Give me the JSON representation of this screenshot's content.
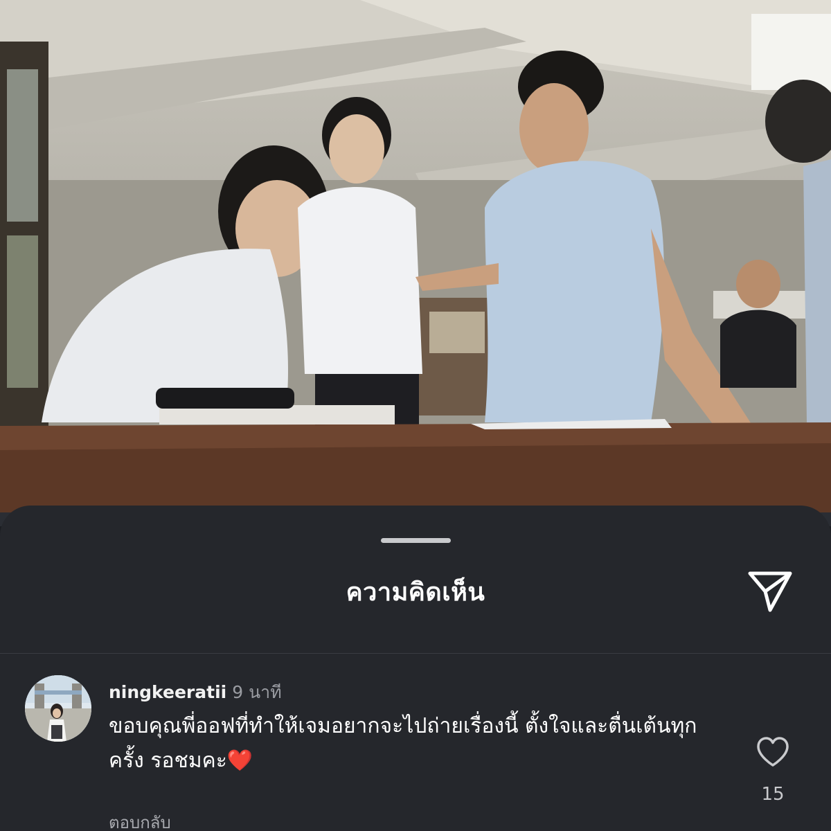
{
  "sheet": {
    "title": "ความคิดเห็น",
    "share_icon": "send-icon"
  },
  "comment": {
    "username": "ningkeeratii",
    "time": "9 นาที",
    "text": "ขอบคุณพี่ออฟที่ทำให้เจมอยากจะไปถ่ายเรื่องนี้ ตั้งใจและตื่นเต้นทุกครั้ง รอชมคะ❤️",
    "reply_label": "ตอบกลับ",
    "like_count": "15",
    "like_icon": "heart-icon",
    "avatar_icon": "avatar"
  },
  "colors": {
    "sheet_background": "#25272c",
    "text_primary": "#ffffff",
    "text_secondary": "#9a9ca2"
  }
}
